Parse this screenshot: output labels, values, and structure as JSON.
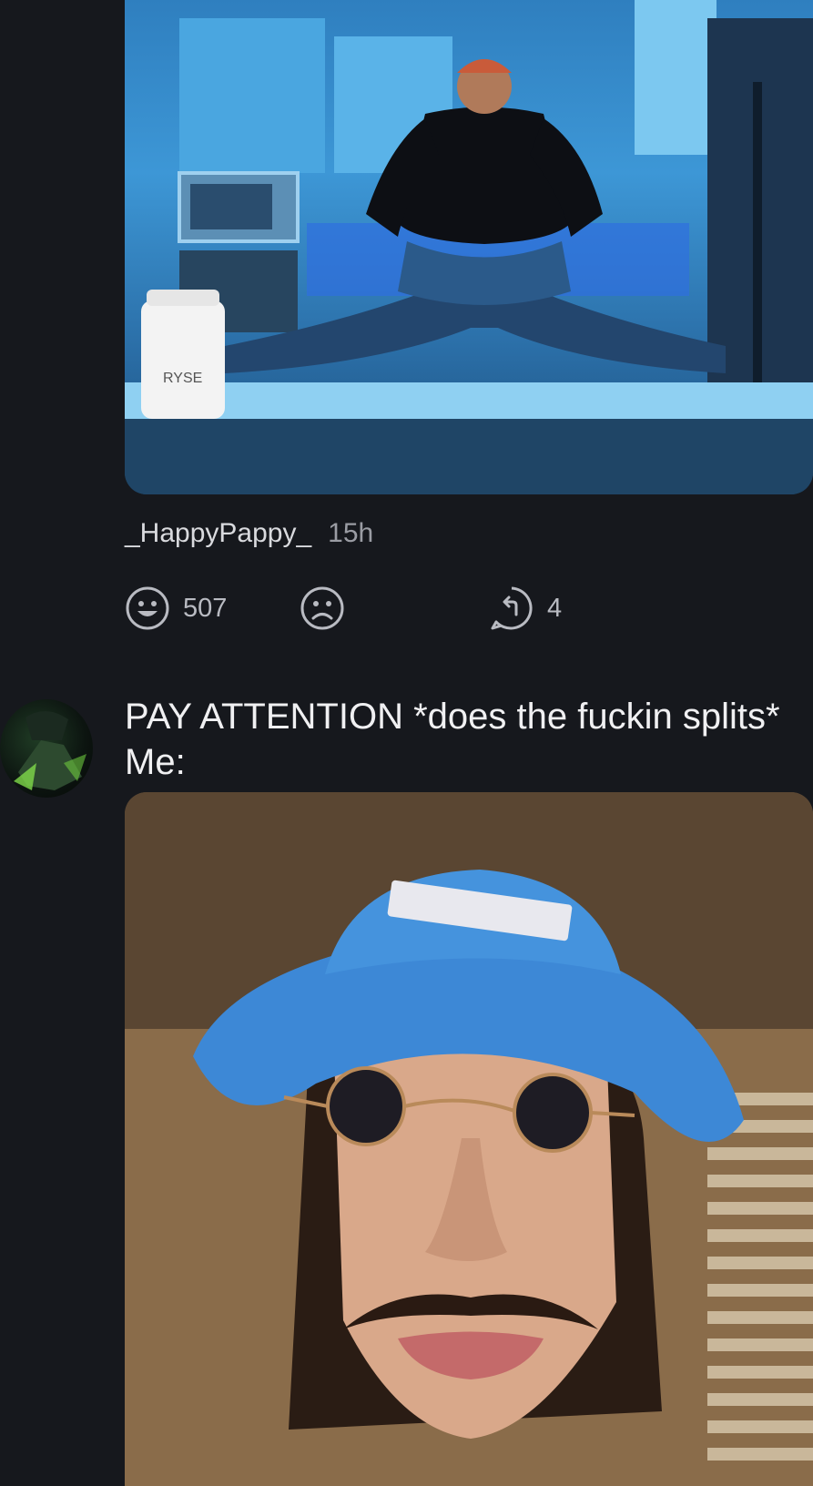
{
  "post1": {
    "image_alt": "",
    "product_label": "RYSE",
    "author": "_HappyPappy_",
    "time": "15h",
    "reactions": {
      "up_count": "507",
      "down_count": "",
      "reply_count": "4"
    },
    "icons": {
      "up": "grinning-face-icon",
      "down": "frowning-face-icon",
      "reply": "reply-arrow-icon"
    }
  },
  "comment2": {
    "avatar_icon": "avatar",
    "text": "PAY ATTENTION *does the fuckin splits* Me:",
    "image_alt": ""
  },
  "colors": {
    "background": "#16181d",
    "text_primary": "#f0f0f2",
    "text_secondary": "#9a9ca3"
  }
}
